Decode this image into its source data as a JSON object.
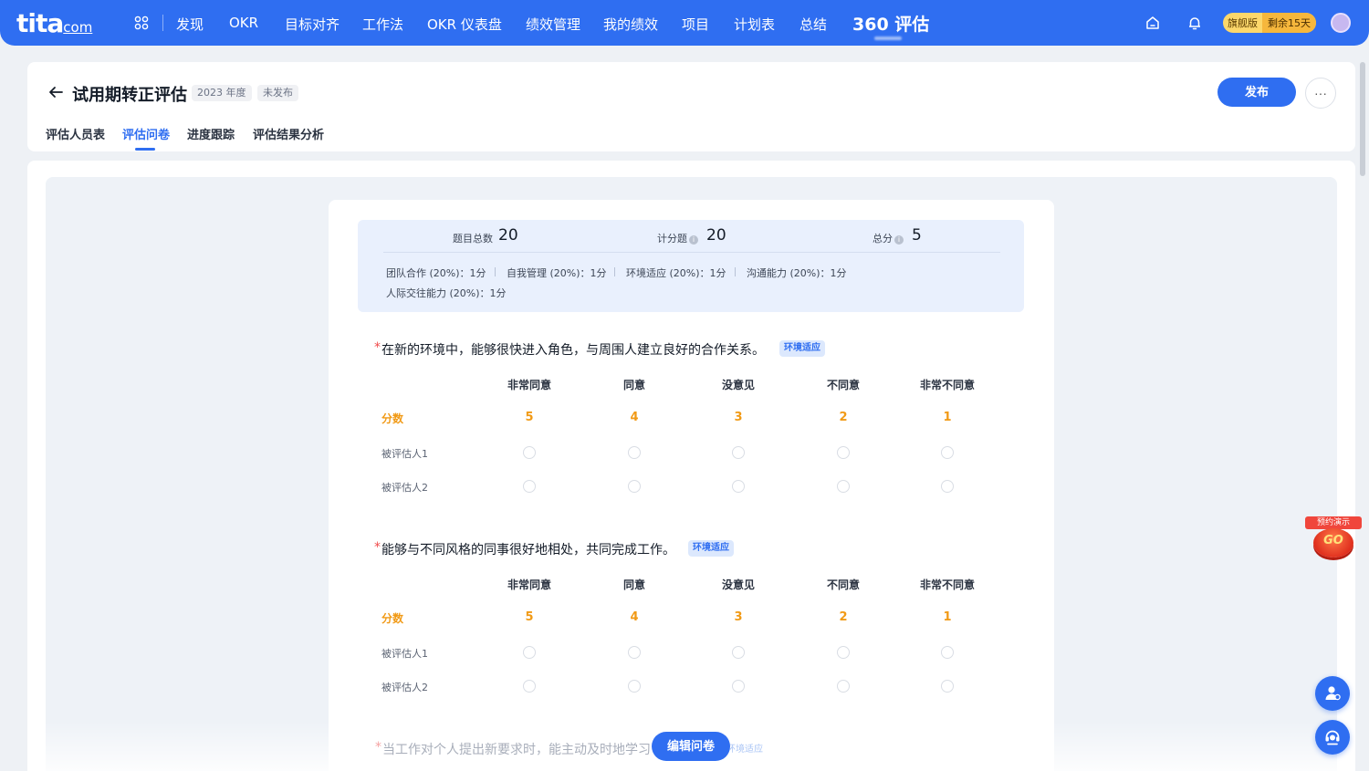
{
  "nav": {
    "logo": "tita",
    "logo_suffix": "com",
    "items": [
      "发现",
      "OKR",
      "目标对齐",
      "工作法",
      "OKR 仪表盘",
      "绩效管理",
      "我的绩效",
      "项目",
      "计划表",
      "总结",
      "360 评估"
    ],
    "edition": "旗舰版",
    "trial": "剩余15天",
    "accent": "#2f6ef1"
  },
  "header": {
    "title": "试用期转正评估",
    "year_tag": "2023 年度",
    "status_tag": "未发布",
    "publish_label": "发布",
    "more_label": "···",
    "tabs": [
      "评估人员表",
      "评估问卷",
      "进度跟踪",
      "评估结果分析"
    ],
    "active_tab": "评估问卷"
  },
  "summary": {
    "total_label": "题目总数",
    "total_value": "20",
    "scored_label": "计分题",
    "scored_value": "20",
    "score_label": "总分",
    "score_value": "5",
    "dimensions": [
      "团队合作 (20%)：1分",
      "自我管理 (20%)：1分",
      "环境适应 (20%)：1分",
      "沟通能力 (20%)：1分",
      "人际交往能力 (20%)：1分"
    ]
  },
  "questions": [
    {
      "title": "在新的环境中，能够很快进入角色，与周围人建立良好的合作关系。",
      "tag": "环境适应",
      "columns": [
        "非常同意",
        "同意",
        "没意见",
        "不同意",
        "非常不同意"
      ],
      "score_label": "分数",
      "scores": [
        "5",
        "4",
        "3",
        "2",
        "1"
      ],
      "rows": [
        "被评估人1",
        "被评估人2"
      ]
    },
    {
      "title": "能够与不同风格的同事很好地相处，共同完成工作。",
      "tag": "环境适应",
      "columns": [
        "非常同意",
        "同意",
        "没意见",
        "不同意",
        "非常不同意"
      ],
      "score_label": "分数",
      "scores": [
        "5",
        "4",
        "3",
        "2",
        "1"
      ],
      "rows": [
        "被评估人1",
        "被评估人2"
      ]
    },
    {
      "title": "当工作对个人提出新要求时，能主动及时地学习",
      "tag": "环境适应"
    }
  ],
  "footer": {
    "edit_label": "编辑问卷"
  },
  "widgets": {
    "demo_label": "预约演示",
    "demo_go": "GO"
  }
}
